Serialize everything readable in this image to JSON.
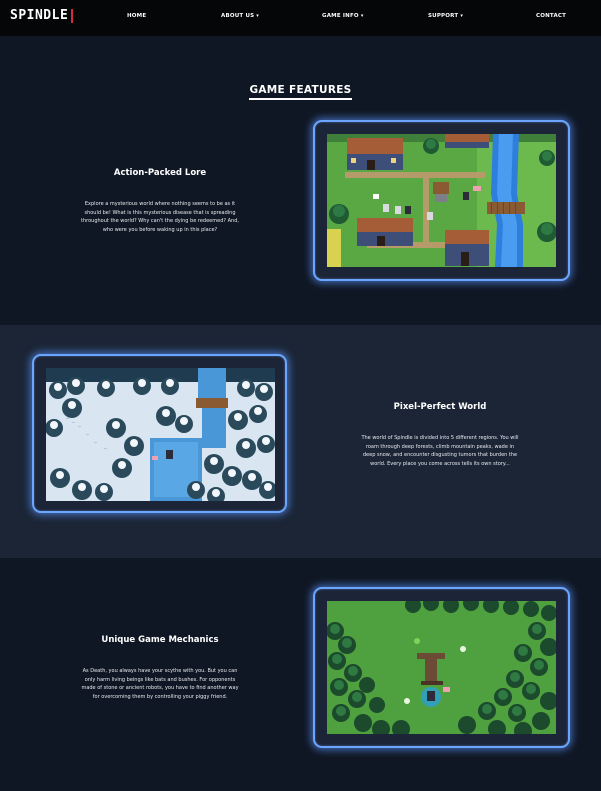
{
  "nav": {
    "logo": "SPINDLE",
    "items": [
      {
        "label": "HOME",
        "dropdown": false
      },
      {
        "label": "ABOUT US",
        "dropdown": true
      },
      {
        "label": "GAME INFO",
        "dropdown": true
      },
      {
        "label": "SUPPORT",
        "dropdown": true
      },
      {
        "label": "CONTACT",
        "dropdown": false
      }
    ],
    "caret": "▾"
  },
  "features_heading": "GAME FEATURES",
  "features": [
    {
      "title": "Action-Packed Lore",
      "lines": [
        "Explore a mysterious world where nothing seems to be as it",
        "should be! What is this mysterious disease that is spreading",
        "throughout the world? Why can't the dying be redeemed? And,",
        "who were you before waking up in this place?"
      ]
    },
    {
      "title": "Pixel-Perfect World",
      "lines": [
        "The world of Spindle is divided into 5 different regions. You will",
        "roam through deep forests, climb mountain peaks, wade in",
        "deep snow, and encounter disgusting tumors that burden the",
        "world. Every place you come across tells its own story..."
      ]
    },
    {
      "title": "Unique Game Mechanics",
      "lines": [
        "As Death, you always have your scythe with you. But you can",
        "only harm living beings like bats and bushes. For opponents",
        "made of stone or ancient robots, you have to find another way",
        "for overcoming them by controlling your piggy friend."
      ]
    }
  ],
  "colors": {
    "accent_red": "#e0263c",
    "frame_glow": "#6aa6ff",
    "bg_dark": "#101724",
    "bg_alt": "#1b2536"
  }
}
